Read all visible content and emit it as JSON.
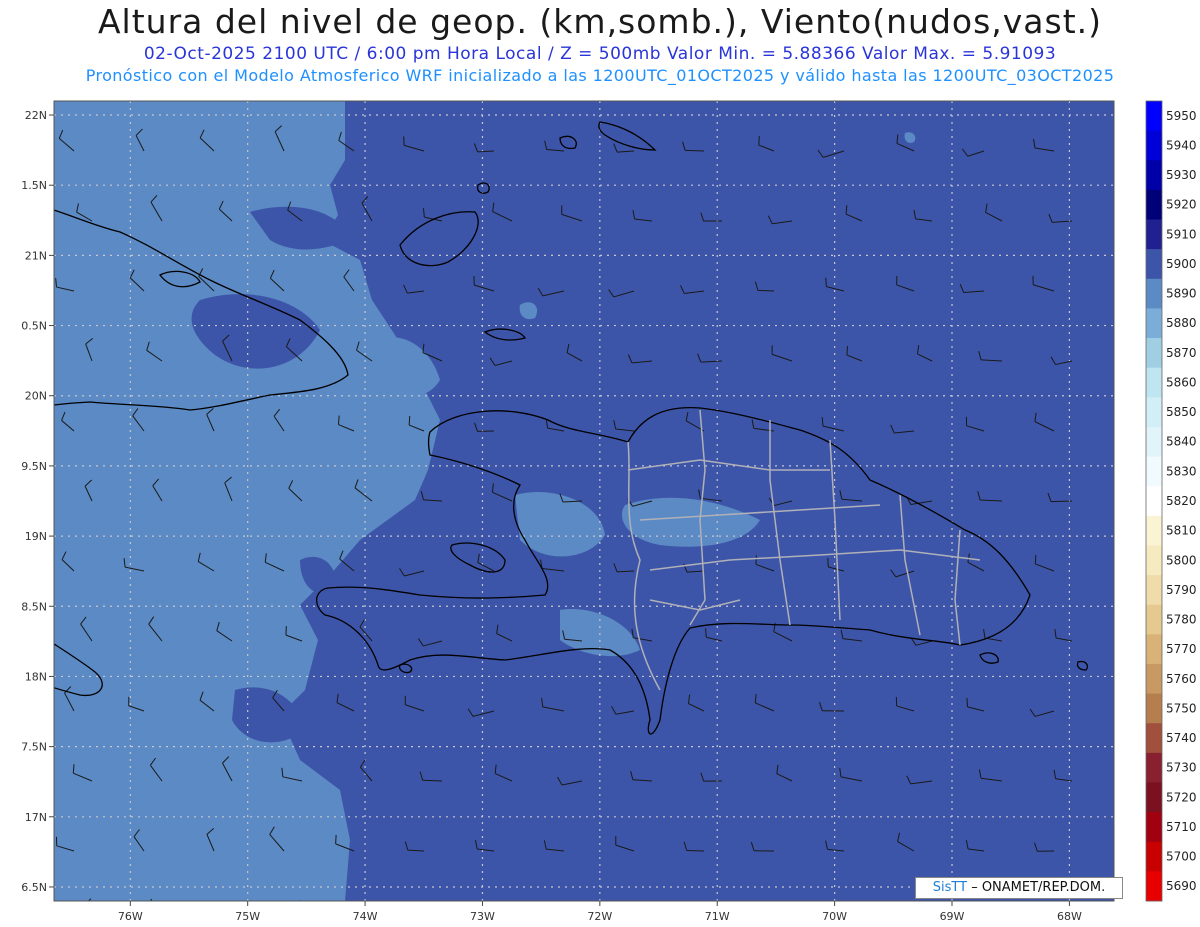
{
  "header": {
    "title": "Altura del nivel de geop. (km,somb.), Viento(nudos,vast.)",
    "subtitle": "02-Oct-2025  2100 UTC / 6:00 pm Hora Local / Z = 500mb     Valor Min. = 5.88366  Valor Max. = 5.91093",
    "forecast_info": "Pronóstico con el Modelo Atmosferico WRF inicializado a las 1200UTC_01OCT2025 y válido hasta las  1200UTC_03OCT2025"
  },
  "chart_data": {
    "type": "heatmap",
    "variable": "Altura del nivel de geop. 500mb",
    "value_min": 5.88366,
    "value_max": 5.91093,
    "x_axis": {
      "ticks": [
        "76W",
        "75W",
        "74W",
        "73W",
        "72W",
        "71W",
        "70W",
        "69W",
        "68W"
      ],
      "lon_values": [
        -76,
        -75,
        -74,
        -73,
        -72,
        -71,
        -70,
        -69,
        -68
      ],
      "range": [
        -76.65,
        -67.62
      ]
    },
    "y_axis": {
      "ticks": [
        "22N",
        "1.5N",
        "21N",
        "0.5N",
        "20N",
        "9.5N",
        "19N",
        "8.5N",
        "18N",
        "7.5N",
        "17N",
        "6.5N"
      ],
      "lat_values": [
        22,
        21.5,
        21,
        20.5,
        20,
        19.5,
        19,
        18.5,
        18,
        17.5,
        17,
        16.5
      ],
      "range": [
        16.4,
        22.1
      ]
    },
    "grid": true,
    "colorbar": {
      "position": "right",
      "levels": [
        5950,
        5940,
        5930,
        5920,
        5910,
        5900,
        5890,
        5880,
        5870,
        5860,
        5850,
        5840,
        5830,
        5820,
        5810,
        5800,
        5790,
        5780,
        5770,
        5760,
        5750,
        5740,
        5730,
        5720,
        5710,
        5700,
        5690
      ],
      "colors": [
        "#0000ff",
        "#0000d8",
        "#0000a8",
        "#000078",
        "#202090",
        "#3d55a8",
        "#5b8ac4",
        "#7aaed8",
        "#a0cfe4",
        "#bfe6f0",
        "#d2eef6",
        "#e0f4fa",
        "#f0faff",
        "#ffffff",
        "#fbf4d4",
        "#f5eac0",
        "#efdcaa",
        "#e6c98e",
        "#d8b277",
        "#c89962",
        "#b57e4e",
        "#a0503c",
        "#882030",
        "#7a1020",
        "#a00010",
        "#c80000",
        "#e80000"
      ]
    },
    "shading": {
      "west_color": "#5b8ac4",
      "east_color": "#3d55a8"
    },
    "wind_barbs": "wind barbs in knots shown over the domain"
  },
  "credit": {
    "brand": "SisTT",
    "text": " – ONAMET/REP.DOM."
  }
}
